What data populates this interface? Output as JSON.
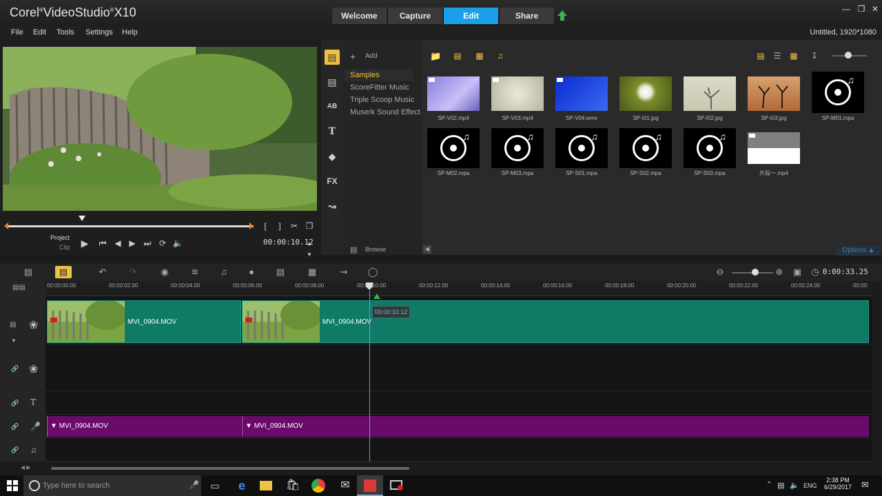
{
  "app": {
    "brand_prefix": "Corel",
    "brand_name": "VideoStudio",
    "brand_version": "X10",
    "project_info": "Untitled, 1920*1080",
    "window_controls": [
      "minimize-icon",
      "restore-icon",
      "close-icon"
    ]
  },
  "workspace_tabs": [
    {
      "label": "Welcome",
      "active": false
    },
    {
      "label": "Capture",
      "active": false
    },
    {
      "label": "Edit",
      "active": true
    },
    {
      "label": "Share",
      "active": false
    }
  ],
  "menu": [
    "File",
    "Edit",
    "Tools",
    "Settings",
    "Help"
  ],
  "player": {
    "mode_project": "Project",
    "mode_clip": "Clip",
    "timecode": "00:00:10.12",
    "scrub_position": 0.31,
    "controls": [
      "play-icon",
      "home-icon",
      "prev-frame-icon",
      "next-frame-icon",
      "end-icon",
      "repeat-icon",
      "volume-icon"
    ],
    "mark_controls": [
      "mark-in-icon",
      "mark-out-icon",
      "split-icon",
      "enlarge-icon"
    ]
  },
  "library": {
    "add_label": "Add",
    "browse_label": "Browse",
    "options_label": "Options",
    "folders": [
      {
        "label": "Samples",
        "active": true
      },
      {
        "label": "ScoreFitter Music",
        "active": false
      },
      {
        "label": "Triple Scoop Music",
        "active": false
      },
      {
        "label": "Muserk Sound Effect",
        "active": false
      }
    ],
    "side_icons": [
      "media-icon",
      "instant-project-icon",
      "transition-icon",
      "title-icon",
      "graphic-icon",
      "filter-icon",
      "path-icon"
    ],
    "items": [
      {
        "name": "SP-V02.mp4",
        "kind": "video",
        "color": "#9f93e8"
      },
      {
        "name": "SP-V03.mp4",
        "kind": "video",
        "color": "#d8d4c0"
      },
      {
        "name": "SP-V04.wmv",
        "kind": "video",
        "color": "#1a3ad8"
      },
      {
        "name": "SP-I01.jpg",
        "kind": "image",
        "color": "#7a8b2a"
      },
      {
        "name": "SP-I02.jpg",
        "kind": "image",
        "color": "#d9d7c6"
      },
      {
        "name": "SP-I03.jpg",
        "kind": "image",
        "color": "#c78a52"
      },
      {
        "name": "SP-M01.mpa",
        "kind": "audio",
        "color": "#000000"
      },
      {
        "name": "SP-M02.mpa",
        "kind": "audio",
        "color": "#000000"
      },
      {
        "name": "SP-M03.mpa",
        "kind": "audio",
        "color": "#000000"
      },
      {
        "name": "SP-S01.mpa",
        "kind": "audio",
        "color": "#000000"
      },
      {
        "name": "SP-S02.mpa",
        "kind": "audio",
        "color": "#000000"
      },
      {
        "name": "SP-S03.mpa",
        "kind": "audio",
        "color": "#000000"
      },
      {
        "name": "片段一.mp4",
        "kind": "video",
        "color": "#808080"
      }
    ]
  },
  "timeline": {
    "total_time": "0:00:33.25",
    "ticks": [
      "00:00:00.00",
      "00:00:02.00",
      "00:00:04.00",
      "00:00:06.00",
      "00:00:08.00",
      "00:00:10.00",
      "00:00:12.00",
      "00:00:14.00",
      "00:00:16.00",
      "00:00:18.00",
      "00:00:20.00",
      "00:00:22.00",
      "00:00:24.00",
      "00:00:"
    ],
    "playhead_tip": "00:00:10.12",
    "video_clips": [
      "MVI_0904.MOV",
      "MVI_0904.MOV"
    ],
    "audio_clips": [
      "MVI_0904.MOV",
      "MVI_0904.MOV"
    ]
  },
  "taskbar": {
    "search_placeholder": "Type here to search",
    "language": "ENG",
    "time": "2:38 PM",
    "date": "6/29/2017"
  },
  "colors": {
    "accent_blue": "#1aa0e8",
    "video_track": "#0f7a66",
    "audio_track": "#6a0a6a",
    "highlight": "#f0c040",
    "scrub_marker": "#f08020"
  }
}
